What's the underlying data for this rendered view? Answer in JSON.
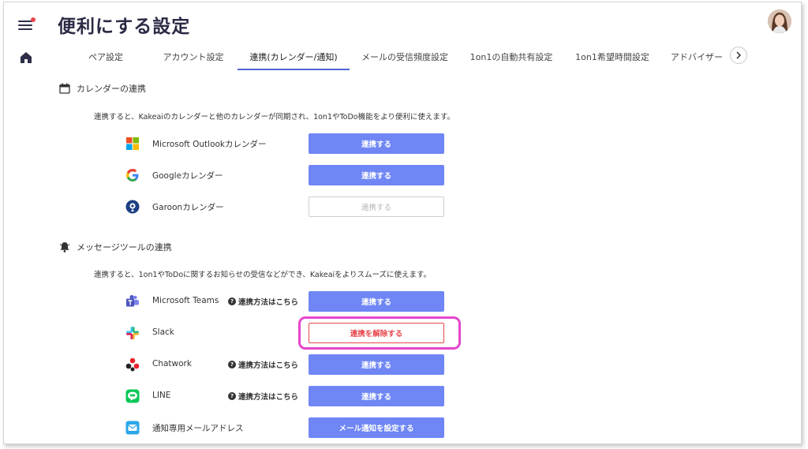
{
  "page": {
    "title": "便利にする設定"
  },
  "tabs": [
    {
      "label": "ペア設定",
      "active": false
    },
    {
      "label": "アカウント設定",
      "active": false
    },
    {
      "label": "連携(カレンダー/通知)",
      "active": true
    },
    {
      "label": "メールの受信頻度設定",
      "active": false
    },
    {
      "label": "1on1の自動共有設定",
      "active": false
    },
    {
      "label": "1on1希望時間設定",
      "active": false
    },
    {
      "label": "アドバイザー",
      "active": false
    }
  ],
  "calendar_section": {
    "title": "カレンダーの連携",
    "description": "連携すると、Kakeaiのカレンダーと他のカレンダーが同期され、1on1やToDo機能をより便利に使えます。",
    "services": [
      {
        "name": "Microsoft Outlookカレンダー",
        "icon": "microsoft-icon",
        "button": "連携する",
        "state": "primary"
      },
      {
        "name": "Googleカレンダー",
        "icon": "google-icon",
        "button": "連携する",
        "state": "primary"
      },
      {
        "name": "Garoonカレンダー",
        "icon": "garoon-icon",
        "button": "連携する",
        "state": "disabled"
      }
    ]
  },
  "message_section": {
    "title": "メッセージツールの連携",
    "description": "連携すると、1on1やToDoに関するお知らせの受信などができ、Kakeaiをよりスムーズに使えます。",
    "help_label": "連携方法はこちら",
    "help_icon": "?",
    "services": [
      {
        "name": "Microsoft Teams",
        "icon": "teams-icon",
        "button": "連携する",
        "state": "primary",
        "help": true
      },
      {
        "name": "Slack",
        "icon": "slack-icon",
        "button": "連携を解除する",
        "state": "danger",
        "help": false
      },
      {
        "name": "Chatwork",
        "icon": "chatwork-icon",
        "button": "連携する",
        "state": "primary",
        "help": true
      },
      {
        "name": "LINE",
        "icon": "line-icon",
        "button": "連携する",
        "state": "primary",
        "help": true
      },
      {
        "name": "通知専用メールアドレス",
        "icon": "mail-icon",
        "button": "メール通知を設定する",
        "state": "primary",
        "help": false
      }
    ]
  },
  "colors": {
    "primary": "#6f86f4",
    "danger": "#e8464b",
    "highlight": "#e845cc",
    "tab_underline": "#4b66d8",
    "title": "#2a2a44"
  }
}
